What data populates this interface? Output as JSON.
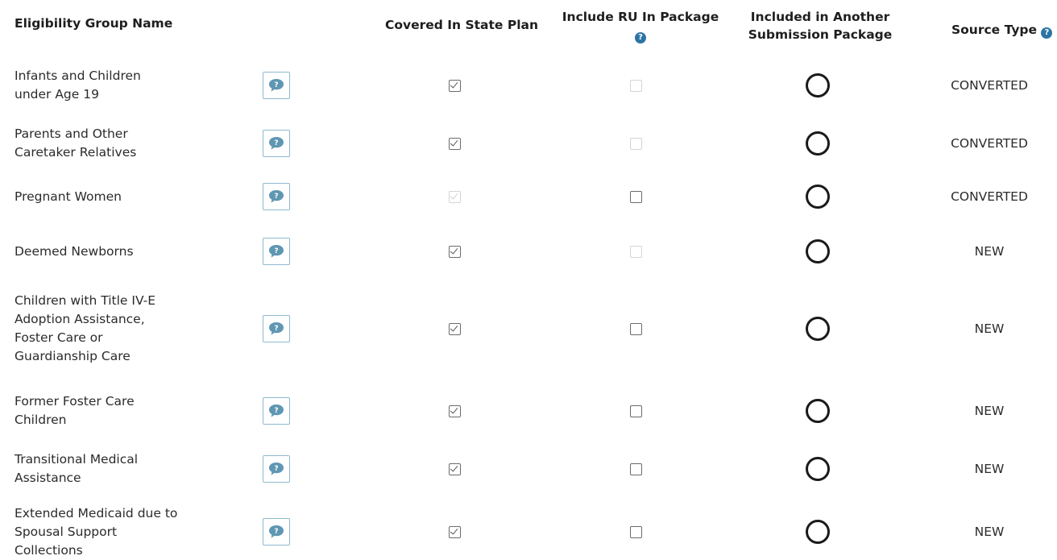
{
  "table": {
    "headers": {
      "name": "Eligibility Group Name",
      "covered": "Covered In State Plan",
      "include_ru": "Include RU In Package",
      "included_another_line1": "Included in Another",
      "included_another_line2": "Submission Package",
      "source_type": "Source Type"
    },
    "help_icon_glyph": "?",
    "rows": [
      {
        "name": "Infants and Children under Age 19",
        "covered_checked": true,
        "covered_enabled": true,
        "include_ru_checked": false,
        "include_ru_enabled": false,
        "included_in_another": false,
        "source_type": "CONVERTED"
      },
      {
        "name": "Parents and Other Caretaker Relatives",
        "covered_checked": true,
        "covered_enabled": true,
        "include_ru_checked": false,
        "include_ru_enabled": false,
        "included_in_another": false,
        "source_type": "CONVERTED"
      },
      {
        "name": "Pregnant Women",
        "covered_checked": true,
        "covered_enabled": false,
        "include_ru_checked": false,
        "include_ru_enabled": true,
        "included_in_another": false,
        "source_type": "CONVERTED"
      },
      {
        "name": "Deemed Newborns",
        "covered_checked": true,
        "covered_enabled": true,
        "include_ru_checked": false,
        "include_ru_enabled": false,
        "included_in_another": false,
        "source_type": "NEW"
      },
      {
        "name": "Children with Title IV-E Adoption Assistance, Foster Care or Guardianship Care",
        "covered_checked": true,
        "covered_enabled": true,
        "include_ru_checked": false,
        "include_ru_enabled": true,
        "included_in_another": false,
        "source_type": "NEW"
      },
      {
        "name": "Former Foster Care Children",
        "covered_checked": true,
        "covered_enabled": true,
        "include_ru_checked": false,
        "include_ru_enabled": true,
        "included_in_another": false,
        "source_type": "NEW"
      },
      {
        "name": "Transitional Medical Assistance",
        "covered_checked": true,
        "covered_enabled": true,
        "include_ru_checked": false,
        "include_ru_enabled": true,
        "included_in_another": false,
        "source_type": "NEW"
      },
      {
        "name": "Extended Medicaid due to Spousal Support Collections",
        "covered_checked": true,
        "covered_enabled": true,
        "include_ru_checked": false,
        "include_ru_enabled": true,
        "included_in_another": false,
        "source_type": "NEW"
      }
    ],
    "icons": {
      "comment": "comment-icon",
      "help": "help-icon",
      "checkbox": "checkbox",
      "radio": "radio-button"
    },
    "colors": {
      "comment_accent": "#5f97b3",
      "help_accent": "#2d74a6"
    }
  }
}
